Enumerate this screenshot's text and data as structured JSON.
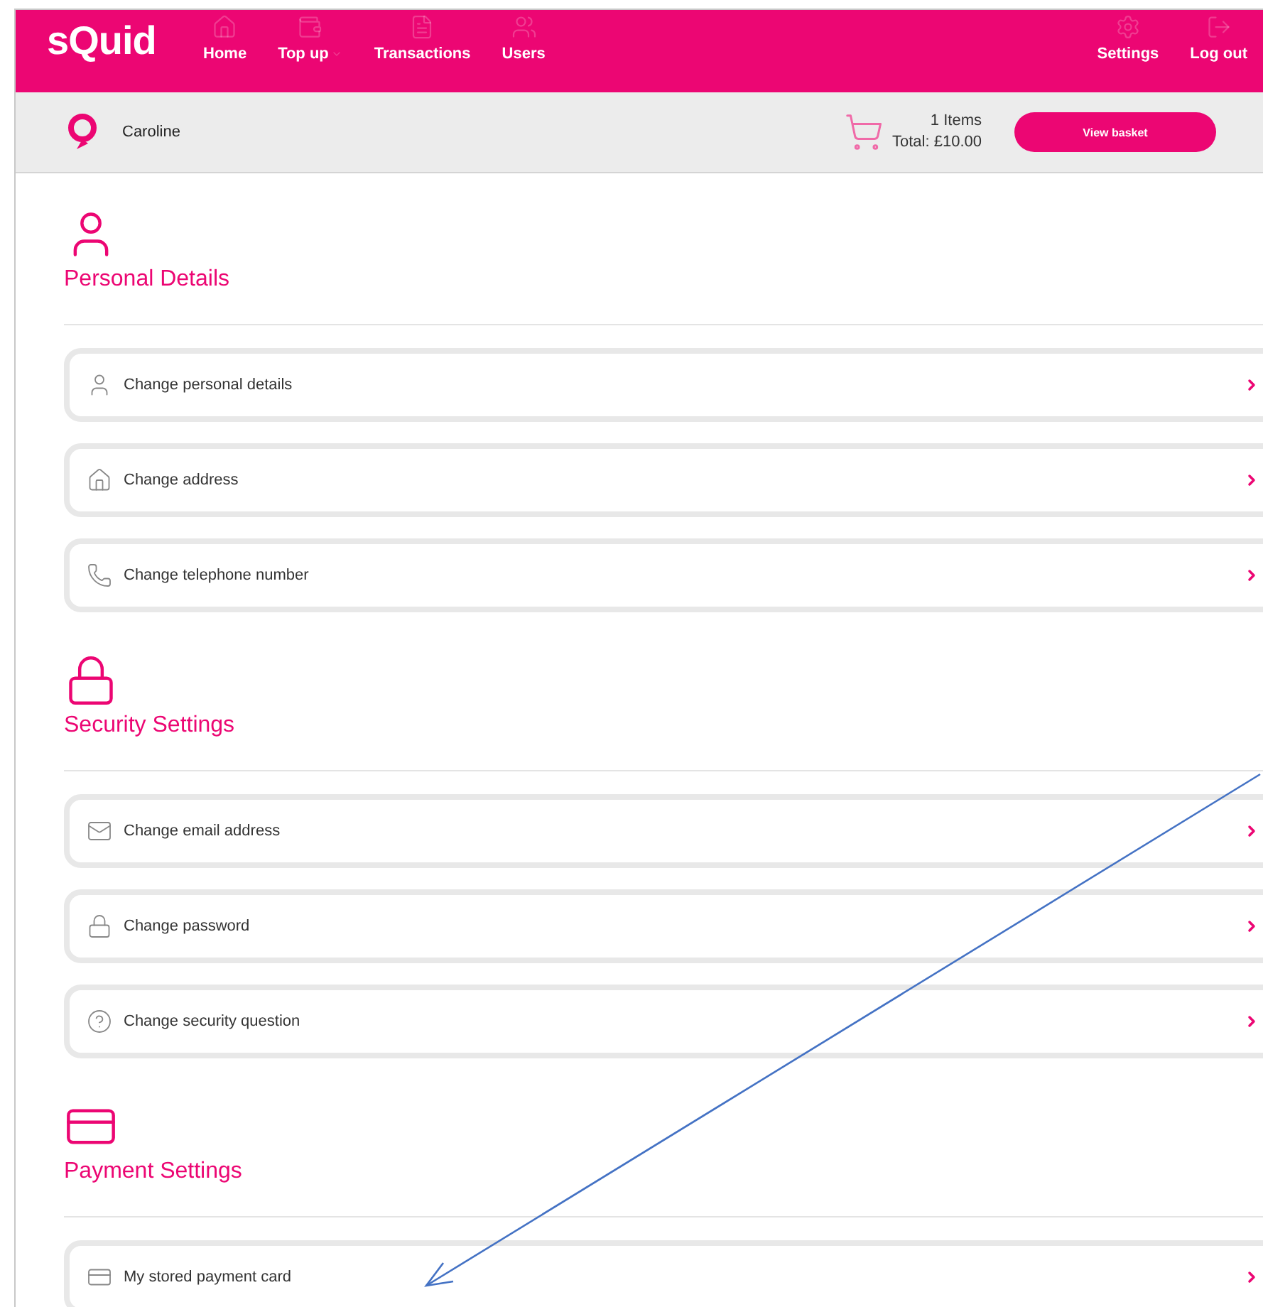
{
  "header": {
    "logo": "sQuid",
    "nav": [
      {
        "label": "Home",
        "kind": "home",
        "dropdown": false
      },
      {
        "label": "Top up",
        "kind": "topup",
        "dropdown": true
      },
      {
        "label": "Transactions",
        "kind": "transactions",
        "dropdown": false
      },
      {
        "label": "Users",
        "kind": "users",
        "dropdown": false
      }
    ],
    "right_nav": [
      {
        "label": "Settings",
        "kind": "settings"
      },
      {
        "label": "Log out",
        "kind": "logout"
      }
    ]
  },
  "account_bar": {
    "user": "Caroline",
    "basket_count": "1 Items",
    "basket_total": "Total: £10.00",
    "button": "View basket"
  },
  "sections": [
    {
      "title": "Personal Details",
      "kind": "person",
      "items": [
        {
          "label": "Change personal details",
          "kind": "person"
        },
        {
          "label": "Change address",
          "kind": "home"
        },
        {
          "label": "Change telephone number",
          "kind": "phone"
        }
      ]
    },
    {
      "title": "Security Settings",
      "kind": "lock",
      "items": [
        {
          "label": "Change email address",
          "kind": "mail"
        },
        {
          "label": "Change password",
          "kind": "lock"
        },
        {
          "label": "Change security question",
          "kind": "question"
        }
      ]
    },
    {
      "title": "Payment Settings",
      "kind": "cards",
      "items": [
        {
          "label": "My stored payment card",
          "kind": "cards"
        }
      ]
    }
  ],
  "annotation": {
    "kind": "arrow"
  }
}
